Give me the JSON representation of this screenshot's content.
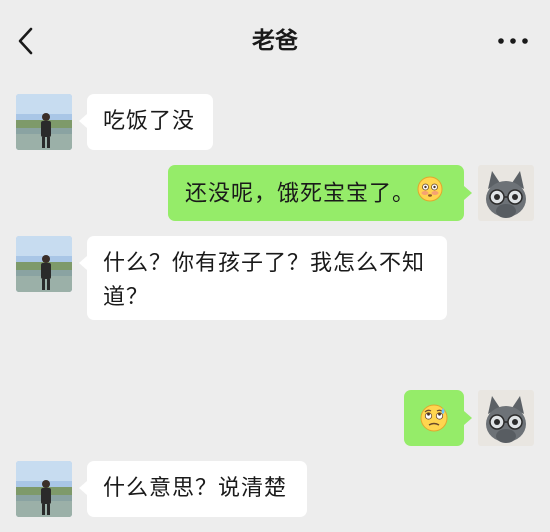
{
  "header": {
    "title": "老爸",
    "back_icon": "chevron-left-icon",
    "more_icon": "more-dots-icon"
  },
  "colors": {
    "background": "#ededed",
    "incoming_bubble": "#ffffff",
    "outgoing_bubble": "#95ec69"
  },
  "messages": [
    {
      "sender": "dad",
      "text": "吃饭了没"
    },
    {
      "sender": "me",
      "text": "还没呢，饿死宝宝了。",
      "emoji": "flushed-face-emoji"
    },
    {
      "sender": "dad",
      "line1": "什么？你有孩子了？我怎么不知",
      "line2": "道？"
    },
    {
      "sender": "me",
      "emoji": "rolling-eyes-sweat-emoji"
    },
    {
      "sender": "dad",
      "text": "什么意思？说清楚"
    }
  ]
}
